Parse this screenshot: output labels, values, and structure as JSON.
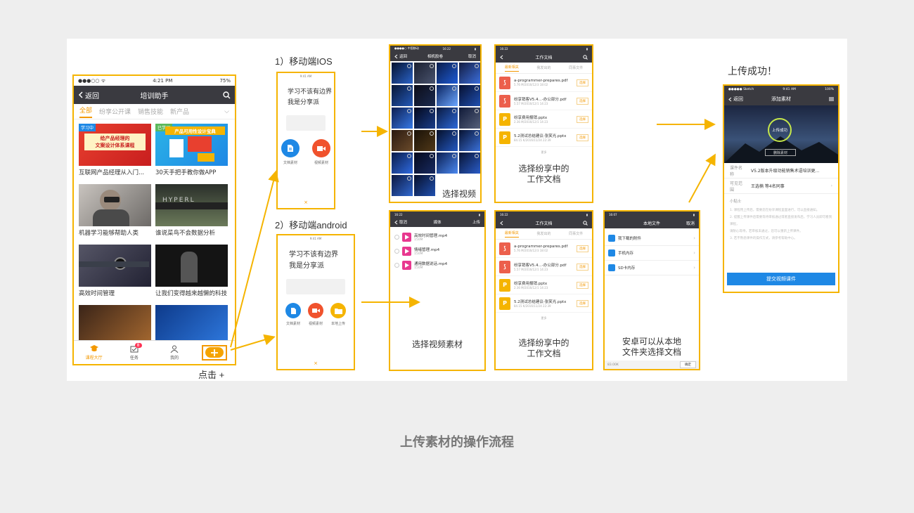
{
  "labels": {
    "ios": "1）移动端IOS",
    "android": "2）移动端android",
    "click_plus": "点击 +",
    "upload_success": "上传成功！",
    "select_video": "选择视频",
    "select_docs_1": "选择纷享中的",
    "select_docs_2": "工作文档",
    "select_video_material": "选择视频素材",
    "local_1": "安卓可以从本地",
    "local_2": "文件夹选择文档",
    "footer": "上传素材的操作流程"
  },
  "colors": {
    "accent": "#f5b400",
    "orange": "#f39800",
    "dark_bar": "#3a3a40",
    "blue": "#1e88e5"
  },
  "phone1": {
    "status_left": "●●●○○ ᯤ",
    "status_time": "4:21 PM",
    "status_right": "75%",
    "back": "返回",
    "title": "培训助手",
    "tabs": [
      "全部",
      "纷享公开课",
      "销售技能",
      "新产品"
    ],
    "cards": [
      {
        "title": "互联网产品经理从入门...",
        "tag": "学习中",
        "banner_1": "给产品经理的",
        "banner_2": "文案设计体系课程"
      },
      {
        "title": "30天手把手教你做APP",
        "tag": "已学习",
        "banner_1": "产品可用性设计宝典"
      },
      {
        "title": "机器学习能够帮助人类"
      },
      {
        "title": "谁说菜鸟不会数据分析"
      },
      {
        "title": "高效时间管理"
      },
      {
        "title": "让我们变得越来越懒的科技"
      },
      {
        "title": ""
      },
      {
        "title": ""
      }
    ],
    "bottom": [
      "课程大厅",
      "任务",
      "我的"
    ],
    "badge": "8"
  },
  "share": {
    "status": "9:41 AM",
    "line1": "学习不该有边界",
    "line2": "我是分享派",
    "doc": "文档素材",
    "video": "视频素材",
    "local": "本地上传"
  },
  "gallery": {
    "status_left": "●●●●○ 中国移动",
    "status_time": "16:22",
    "back": "返回",
    "title": "相机胶卷",
    "cancel": "取消"
  },
  "docs": {
    "status_time": "16:22",
    "title": "工作文档",
    "tabs": [
      "最新相关",
      "我发出的",
      "同事文件"
    ],
    "items": [
      {
        "name": "a-programmer-prepares.pdf",
        "meta": "5.76 M/2016/12/3 18:02",
        "type": "pdf"
      },
      {
        "name": "纷享销客V5.4...-办公部分.pdf",
        "meta": "5.57 M/2016/12/1 14:23",
        "type": "pdf"
      },
      {
        "name": "纷享费用报销.pptx",
        "meta": "2.36 M/2016/12/1 14:23",
        "type": "ppt"
      },
      {
        "name": "5.2测试总结建议-张笑光.pptx",
        "meta": "84.15 K/2016/11/24 22:39",
        "type": "ppt"
      }
    ],
    "select": "选择",
    "more": "更多"
  },
  "media": {
    "status_time": "16:22",
    "cancel": "取消",
    "title": "媒体",
    "upload": "上传",
    "items": [
      {
        "name": "高效时间管理.mp4",
        "size": "150M"
      },
      {
        "name": "情绪管理.mp4",
        "size": "150M"
      },
      {
        "name": "通用数据说话.mp4",
        "size": "150M"
      }
    ]
  },
  "local": {
    "status_time": "16:07",
    "title": "本地文件",
    "cancel": "取消",
    "items": [
      "我下载的附件",
      "手机内存",
      "SD卡内存"
    ],
    "size": "83.00K",
    "confirm": "确定"
  },
  "success": {
    "status_left": "●●●●● Sketch",
    "status_time": "9:41 AM",
    "status_right": "100%",
    "back": "返回",
    "title": "添加素材",
    "circle": "上传成功",
    "delete": "删除素材",
    "course_label": "课件名称",
    "course_value": "V5.2版本升级功能销售术语培训更...",
    "range_label": "可见范围",
    "range_value": "王选楠 等4名同事",
    "tips_title": "小贴士",
    "tips": [
      "1. 课程用上传后，需要您在纷享课程里面进行，可以直接通知。",
      "2. 提醒上传课件后需要等待审核通过或者直接发布后，学习人员即可看到课程，",
      "   请耐心等待，若审核未通过，您可以重新上传课件。",
      "3. 若不熟悉课件的操作方式，请参考帮助中心。"
    ],
    "submit": "提交视频课件"
  }
}
